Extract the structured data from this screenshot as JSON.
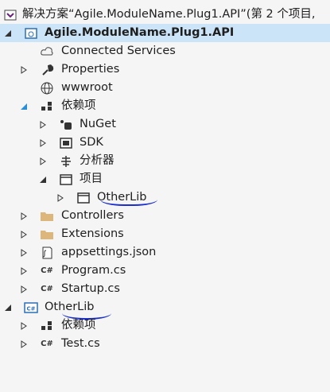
{
  "solution": {
    "label": "解决方案“Agile.ModuleName.Plug1.API”(第 2 个项目,"
  },
  "project1": {
    "name": "Agile.ModuleName.Plug1.API",
    "connected_services": "Connected Services",
    "properties": "Properties",
    "wwwroot": "wwwroot",
    "dependencies": "依赖项",
    "nuget": "NuGet",
    "sdk": "SDK",
    "analyzers": "分析器",
    "projects": "项目",
    "otherlib_ref": "OtherLib",
    "controllers": "Controllers",
    "extensions": "Extensions",
    "appsettings": "appsettings.json",
    "program": "Program.cs",
    "startup": "Startup.cs"
  },
  "project2": {
    "name": "OtherLib",
    "dependencies": "依赖项",
    "test": "Test.cs"
  },
  "colors": {
    "selection": "#cce4f7",
    "ink": "#1b2fd0",
    "folder": "#dcb67a",
    "project": "#2b6fb6"
  }
}
